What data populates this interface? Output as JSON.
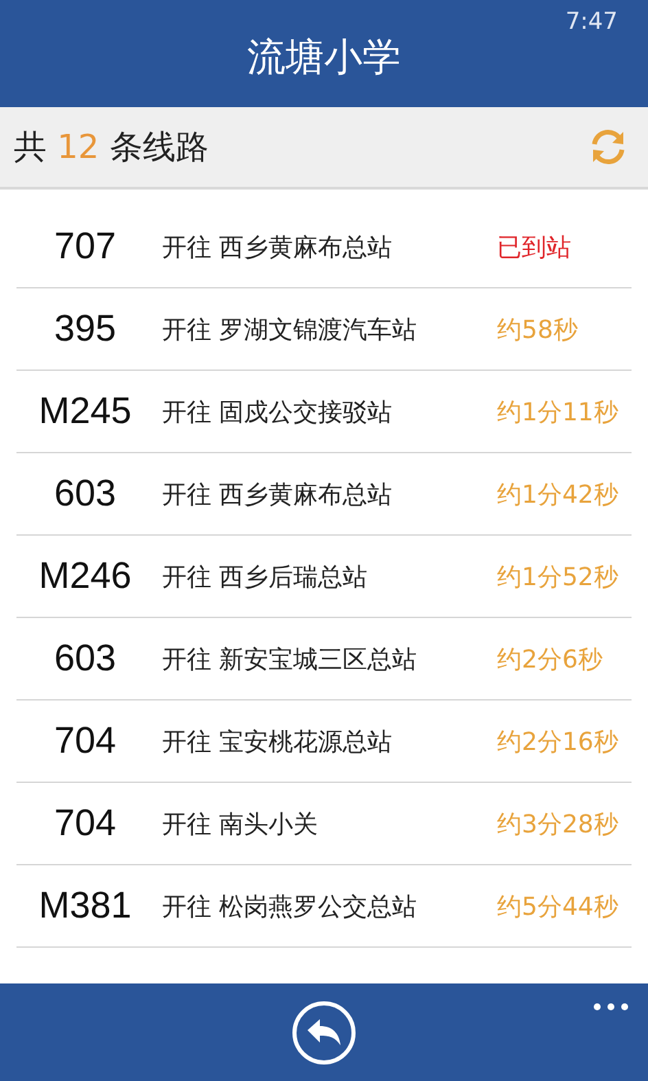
{
  "status_bar": {
    "time": "7:47"
  },
  "header": {
    "title": "流塘小学"
  },
  "summary": {
    "prefix": "共",
    "count": "12",
    "suffix": "条线路"
  },
  "routes": [
    {
      "number": "707",
      "destination": "开往 西乡黄麻布总站",
      "eta": "已到站",
      "arrived": true
    },
    {
      "number": "395",
      "destination": "开往 罗湖文锦渡汽车站",
      "eta": "约58秒",
      "arrived": false
    },
    {
      "number": "M245",
      "destination": "开往 固戍公交接驳站",
      "eta": "约1分11秒",
      "arrived": false
    },
    {
      "number": "603",
      "destination": "开往 西乡黄麻布总站",
      "eta": "约1分42秒",
      "arrived": false
    },
    {
      "number": "M246",
      "destination": "开往 西乡后瑞总站",
      "eta": "约1分52秒",
      "arrived": false
    },
    {
      "number": "603",
      "destination": "开往 新安宝城三区总站",
      "eta": "约2分6秒",
      "arrived": false
    },
    {
      "number": "704",
      "destination": "开往 宝安桃花源总站",
      "eta": "约2分16秒",
      "arrived": false
    },
    {
      "number": "704",
      "destination": "开往 南头小关",
      "eta": "约3分28秒",
      "arrived": false
    },
    {
      "number": "M381",
      "destination": "开往 松岗燕罗公交总站",
      "eta": "约5分44秒",
      "arrived": false
    }
  ]
}
